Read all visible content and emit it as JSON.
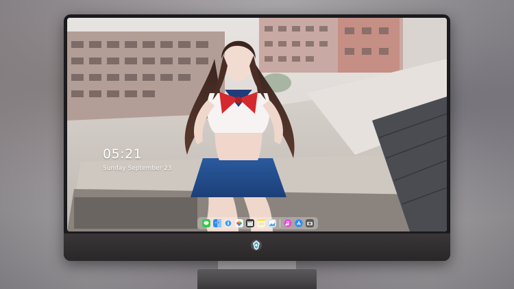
{
  "lock_screen": {
    "time": "05:21",
    "date": "Sunday September 23"
  },
  "dock": {
    "apps": [
      {
        "icon": "messages-icon",
        "color": "#38c84a"
      },
      {
        "icon": "finder-icon",
        "color": "#2f8cf0"
      },
      {
        "icon": "safari-icon",
        "color": "#f4f4f4"
      },
      {
        "icon": "photos-icon",
        "color": "#f5c02d"
      },
      {
        "icon": "clapper-icon",
        "color": "#3b3b3b"
      },
      {
        "icon": "notes-icon",
        "color": "#f7e25d"
      },
      {
        "icon": "preview-icon",
        "color": "#cfe3f5"
      },
      {
        "icon": "itunes-icon",
        "color": "#e24fd2"
      },
      {
        "icon": "app-store-icon",
        "color": "#2d8cf0"
      },
      {
        "icon": "camera-icon",
        "color": "#5a5a5a"
      }
    ]
  },
  "colors": {
    "bezel": "#1b1b1e",
    "chin": "#2f2c2e",
    "stand": "#8a878a"
  }
}
